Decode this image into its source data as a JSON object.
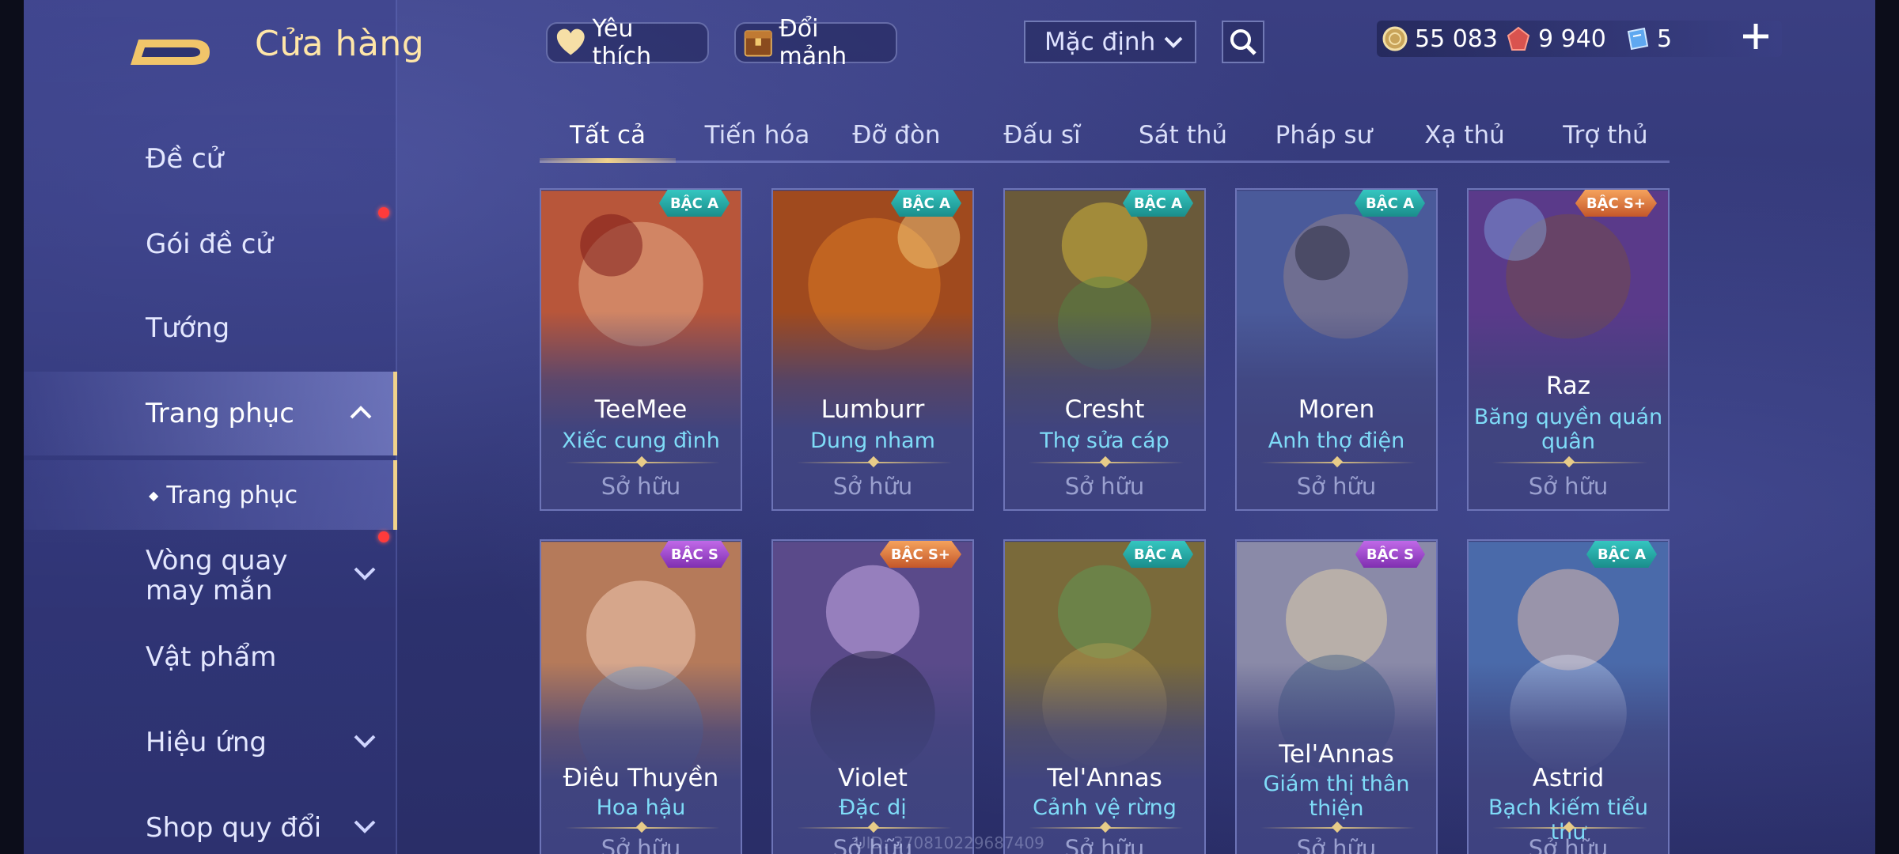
{
  "header": {
    "title": "Cửa hàng",
    "favorite_label": "Yêu thích",
    "exchange_label": "Đổi mảnh",
    "sort_selected": "Mặc định"
  },
  "currency": {
    "gold": "55 083",
    "ruby": "9 940",
    "voucher": "5"
  },
  "sidebar": {
    "items": [
      {
        "label": "Đề cử"
      },
      {
        "label": "Gói đề cử"
      },
      {
        "label": "Tướng"
      },
      {
        "label": "Trang phục"
      },
      {
        "label": "Trang phục"
      },
      {
        "label": "Vòng quay may mắn"
      },
      {
        "label": "Vật phẩm"
      },
      {
        "label": "Hiệu ứng"
      },
      {
        "label": "Shop quy đổi"
      }
    ]
  },
  "tabs": [
    "Tất cả",
    "Tiến hóa",
    "Đỡ đòn",
    "Đấu sĩ",
    "Sát thủ",
    "Pháp sư",
    "Xạ thủ",
    "Trợ thủ"
  ],
  "cards": [
    {
      "hero": "TeeMee",
      "skin": "Xiếc cung đình",
      "status": "Sở hữu",
      "tier": "BẬC A",
      "color": "#b8563a"
    },
    {
      "hero": "Lumburr",
      "skin": "Dung nham",
      "status": "Sở hữu",
      "tier": "BẬC A",
      "color": "#a04a1e"
    },
    {
      "hero": "Cresht",
      "skin": "Thợ sửa cáp",
      "status": "Sở hữu",
      "tier": "BẬC A",
      "color": "#6a5a3a"
    },
    {
      "hero": "Moren",
      "skin": "Anh thợ điện",
      "status": "Sở hữu",
      "tier": "BẬC A",
      "color": "#4a5a9a"
    },
    {
      "hero": "Raz",
      "skin": "Băng quyền quán quân",
      "status": "Sở hữu",
      "tier": "BẬC S+",
      "color": "#5a3a8a"
    },
    {
      "hero": "Điêu Thuyền",
      "skin": "Hoa hậu",
      "status": "Sở hữu",
      "tier": "BẬC S",
      "color": "#b57a5a"
    },
    {
      "hero": "Violet",
      "skin": "Đặc dị",
      "status": "Sở hữu",
      "tier": "BẬC S+",
      "color": "#5a4a8a"
    },
    {
      "hero": "Tel'Annas",
      "skin": "Cảnh vệ rừng",
      "status": "Sở hữu",
      "tier": "BẬC A",
      "color": "#7a6a3a"
    },
    {
      "hero": "Tel'Annas",
      "skin": "Giám thị thân thiện",
      "status": "Sở hữu",
      "tier": "BẬC S",
      "color": "#8a8aa8"
    },
    {
      "hero": "Astrid",
      "skin": "Bạch kiếm tiểu thư",
      "status": "Sở hữu",
      "tier": "BẬC A",
      "color": "#4a6aaa"
    }
  ],
  "footer": {
    "uid": "UID: 370810229687409"
  }
}
